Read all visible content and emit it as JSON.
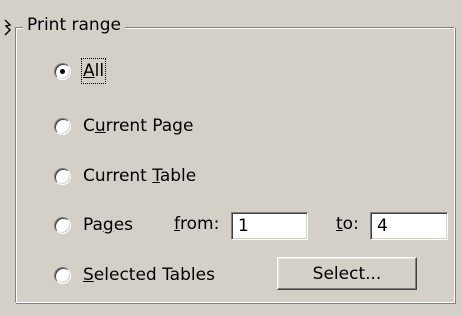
{
  "group": {
    "title": "Print range"
  },
  "options": [
    {
      "label_pre": "",
      "label_ul": "A",
      "label_post": "ll",
      "selected": true
    },
    {
      "label_pre": "C",
      "label_ul": "u",
      "label_post": "rrent Page",
      "selected": false
    },
    {
      "label_pre": "Current ",
      "label_ul": "T",
      "label_post": "able",
      "selected": false
    },
    {
      "label_pre": "Pa",
      "label_ul": "g",
      "label_post": "es",
      "selected": false
    },
    {
      "label_pre": "",
      "label_ul": "S",
      "label_post": "elected Tables",
      "selected": false
    }
  ],
  "pages": {
    "from_label_ul": "f",
    "from_label_post": "rom:",
    "from_value": "1",
    "to_label_ul": "t",
    "to_label_post": "o:",
    "to_value": "4"
  },
  "select_button": {
    "label": "Select..."
  }
}
